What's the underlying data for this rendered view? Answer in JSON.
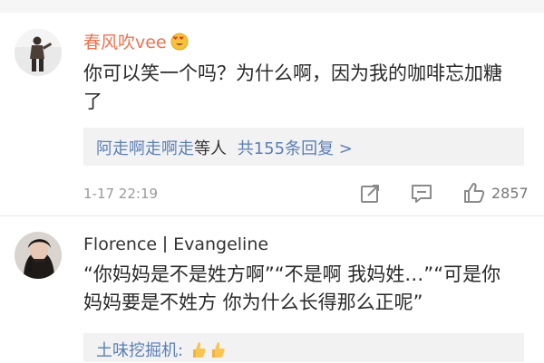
{
  "comment1": {
    "username": "春风吹vee",
    "text_line1": "你可以笑一个吗？为什么啊，因为我的咖啡忘加糖",
    "text_line2": "了",
    "reply_summary": {
      "users": "阿走啊走啊走",
      "middle": "等人",
      "count_label": "共155条回复 >"
    },
    "time": "1-17 22:19",
    "like_count": "2857"
  },
  "comment2": {
    "username_part1": "Florence",
    "username_part2": "Evangeline",
    "text_line1": "“你妈妈是不是姓方啊”“不是啊 我妈姓…”“可是你",
    "text_line2": "妈妈要是不姓方 你为什么长得那么正呢”",
    "reply_preview": {
      "user": "土味挖掘机:"
    }
  },
  "colors": {
    "username_accent": "#eb7350",
    "link_blue": "#5b7fb6",
    "reply_bg": "#f2f2f2"
  }
}
